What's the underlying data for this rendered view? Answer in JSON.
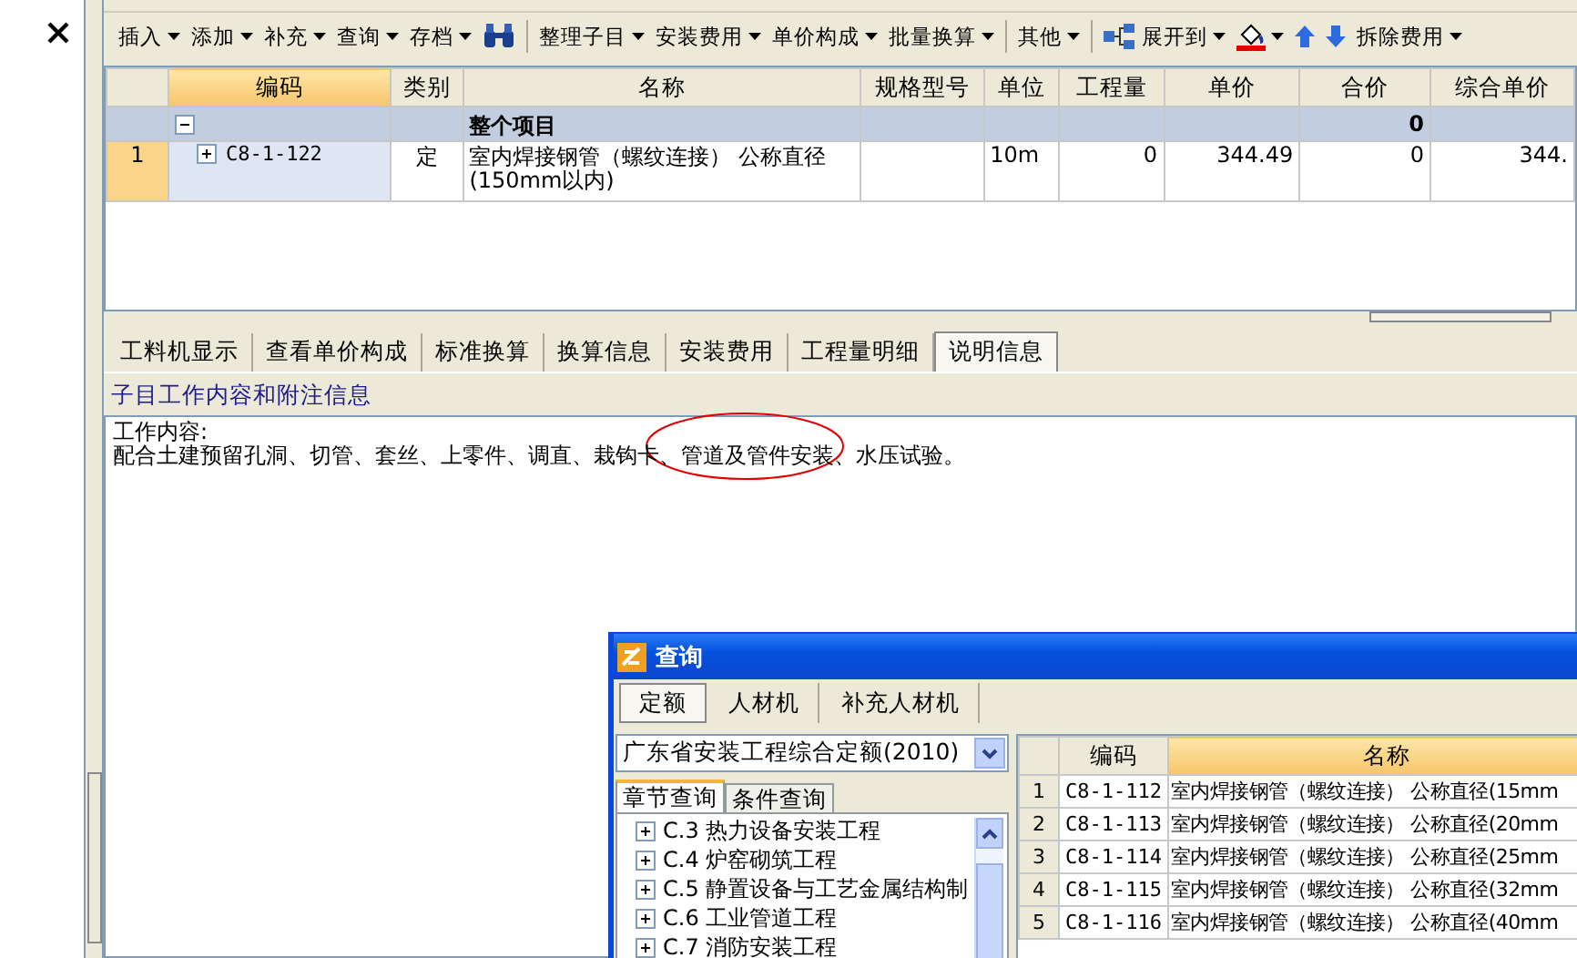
{
  "toolbar": [
    {
      "kind": "menu",
      "label": "插入"
    },
    {
      "kind": "menu",
      "label": "添加"
    },
    {
      "kind": "menu",
      "label": "补充"
    },
    {
      "kind": "menu",
      "label": "查询"
    },
    {
      "kind": "menu",
      "label": "存档"
    },
    {
      "kind": "find"
    },
    {
      "kind": "separator"
    },
    {
      "kind": "menu",
      "label": "整理子目"
    },
    {
      "kind": "menu",
      "label": "安装费用"
    },
    {
      "kind": "menu",
      "label": "单价构成"
    },
    {
      "kind": "menu",
      "label": "批量换算"
    },
    {
      "kind": "separator"
    },
    {
      "kind": "menu",
      "label": "其他"
    },
    {
      "kind": "separator"
    },
    {
      "kind": "expand",
      "label": "展开到"
    },
    {
      "kind": "fill"
    },
    {
      "kind": "up"
    },
    {
      "kind": "down"
    },
    {
      "kind": "menu",
      "label": "拆除费用"
    }
  ],
  "grid": {
    "columns": [
      "编码",
      "类别",
      "名称",
      "规格型号",
      "单位",
      "工程量",
      "单价",
      "合价",
      "综合单价"
    ],
    "rows": [
      {
        "kind": "group",
        "expanded": true,
        "no": "",
        "code": "",
        "type": "",
        "name": "整个项目",
        "spec": "",
        "unit": "",
        "qty": "",
        "price": "",
        "total": "0",
        "unit_total": ""
      },
      {
        "kind": "item",
        "expanded": false,
        "no": "1",
        "code": "C8-1-122",
        "type": "定",
        "name": "室内焊接钢管（螺纹连接） 公称直径(150mm以内)",
        "spec": "",
        "unit": "10m",
        "qty": "0",
        "price": "344.49",
        "total": "0",
        "unit_total": "344."
      }
    ]
  },
  "tabs": [
    {
      "label": "工料机显示",
      "selected": false
    },
    {
      "label": "查看单价构成",
      "selected": false
    },
    {
      "label": "标准换算",
      "selected": false
    },
    {
      "label": "换算信息",
      "selected": false
    },
    {
      "label": "安装费用",
      "selected": false
    },
    {
      "label": "工程量明细",
      "selected": false
    },
    {
      "label": "说明信息",
      "selected": true
    }
  ],
  "info": {
    "title": "子目工作内容和附注信息",
    "lines": [
      "工作内容:",
      "配合土建预留孔洞、切管、套丝、上零件、调直、栽钩卡、管道及管件安装、水压试验。"
    ]
  },
  "dialog": {
    "title": "查询",
    "tabs": [
      {
        "label": "定额",
        "selected": true
      },
      {
        "label": "人材机",
        "selected": false
      },
      {
        "label": "补充人材机",
        "selected": false
      }
    ],
    "dropdown": {
      "value": "广东省安装工程综合定额(2010)"
    },
    "subtabs": [
      {
        "label": "章节查询",
        "selected": true
      },
      {
        "label": "条件查询",
        "selected": false
      }
    ],
    "tree": [
      {
        "label": "C.3 热力设备安装工程",
        "expanded": false
      },
      {
        "label": "C.4 炉窑砌筑工程",
        "expanded": false
      },
      {
        "label": "C.5 静置设备与工艺金属结构制",
        "expanded": false
      },
      {
        "label": "C.6 工业管道工程",
        "expanded": false
      },
      {
        "label": "C.7 消防安装工程",
        "expanded": false
      }
    ],
    "columns": [
      "编码",
      "名称"
    ],
    "rows": [
      {
        "no": "1",
        "code": "C8-1-112",
        "name": "室内焊接钢管（螺纹连接） 公称直径(15mm"
      },
      {
        "no": "2",
        "code": "C8-1-113",
        "name": "室内焊接钢管（螺纹连接） 公称直径(20mm"
      },
      {
        "no": "3",
        "code": "C8-1-114",
        "name": "室内焊接钢管（螺纹连接） 公称直径(25mm"
      },
      {
        "no": "4",
        "code": "C8-1-115",
        "name": "室内焊接钢管（螺纹连接） 公称直径(32mm"
      },
      {
        "no": "5",
        "code": "C8-1-116",
        "name": "室内焊接钢管（螺纹连接） 公称直径(40mm"
      }
    ]
  }
}
